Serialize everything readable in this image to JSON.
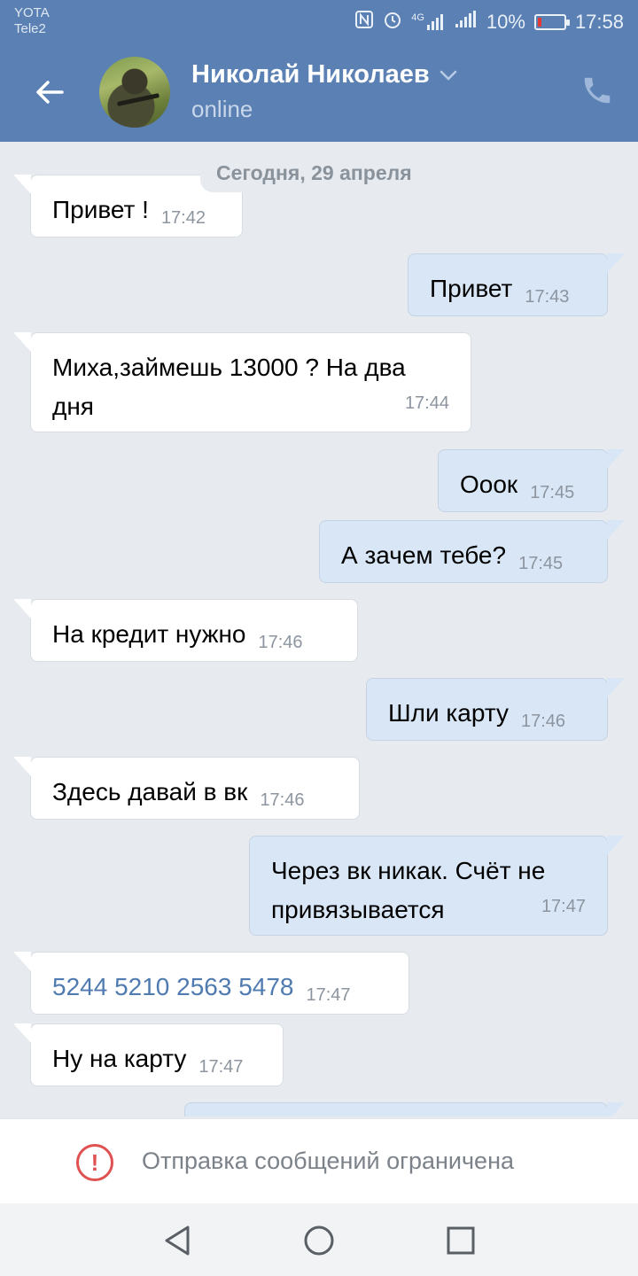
{
  "status_bar": {
    "carrier1": "YOTA",
    "carrier2": "Tele2",
    "network": "4G",
    "battery": "10%",
    "time": "17:58"
  },
  "header": {
    "contact_name": "Николай Николаев",
    "status": "online",
    "icons": [
      "back-arrow-icon",
      "chevron-down-icon",
      "phone-icon"
    ]
  },
  "chat": {
    "date_label": "Сегодня, 29 апреля",
    "messages": [
      {
        "dir": "in",
        "text": "Привет !",
        "time": "17:42"
      },
      {
        "dir": "out",
        "text": "Привет",
        "time": "17:43"
      },
      {
        "dir": "in",
        "text": "Миха,займешь 13000 ? На два\nдня",
        "time": "17:44"
      },
      {
        "dir": "out",
        "text": "Ооок",
        "time": "17:45"
      },
      {
        "dir": "out",
        "text": "А зачем тебе?",
        "time": "17:45"
      },
      {
        "dir": "in",
        "text": "На кредит нужно",
        "time": "17:46"
      },
      {
        "dir": "out",
        "text": "Шли карту",
        "time": "17:46"
      },
      {
        "dir": "in",
        "text": "Здесь давай в вк",
        "time": "17:46"
      },
      {
        "dir": "out",
        "text": "Через вк никак. Счёт не\nпривязывается",
        "time": "17:47"
      },
      {
        "dir": "in",
        "text": "5244 5210 2563 5478",
        "time": "17:47"
      },
      {
        "dir": "in",
        "text": "Ну на карту",
        "time": "17:47"
      }
    ]
  },
  "footer": {
    "blocked_text": "Отправка сообщений ограничена",
    "warning_icon": "!"
  },
  "colors": {
    "header_bg": "#5a80b4",
    "chat_bg": "#e7ebf0",
    "incoming_bubble": "#ffffff",
    "outgoing_bubble": "#d9e6f6",
    "link": "#4f7bb0",
    "warning": "#e05151"
  }
}
